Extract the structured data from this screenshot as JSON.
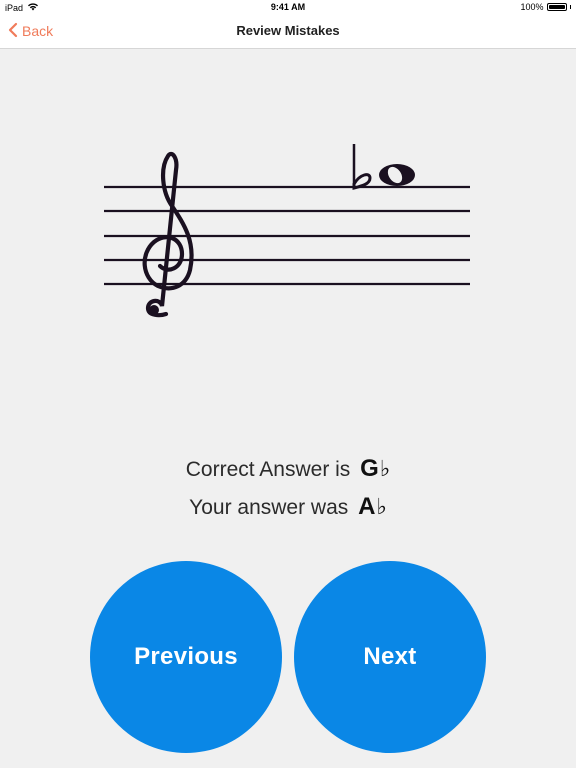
{
  "status_bar": {
    "device": "iPad",
    "time": "9:41 AM",
    "battery_percent": "100%",
    "battery_level": 1.0
  },
  "nav": {
    "back_label": "Back",
    "title": "Review Mistakes"
  },
  "notation": {
    "clef": "treble",
    "note": "G",
    "accidental": "flat"
  },
  "results": {
    "correct_prefix": "Correct Answer is",
    "correct_note": "G",
    "correct_accidental": "♭",
    "user_prefix": "Your answer was",
    "user_note": "A",
    "user_accidental": "♭"
  },
  "buttons": {
    "previous_label": "Previous",
    "next_label": "Next"
  },
  "colors": {
    "accent": "#f07b5a",
    "button_blue": "#0a87e6",
    "background": "#f0f0f0",
    "staff_ink": "#1a1020"
  }
}
